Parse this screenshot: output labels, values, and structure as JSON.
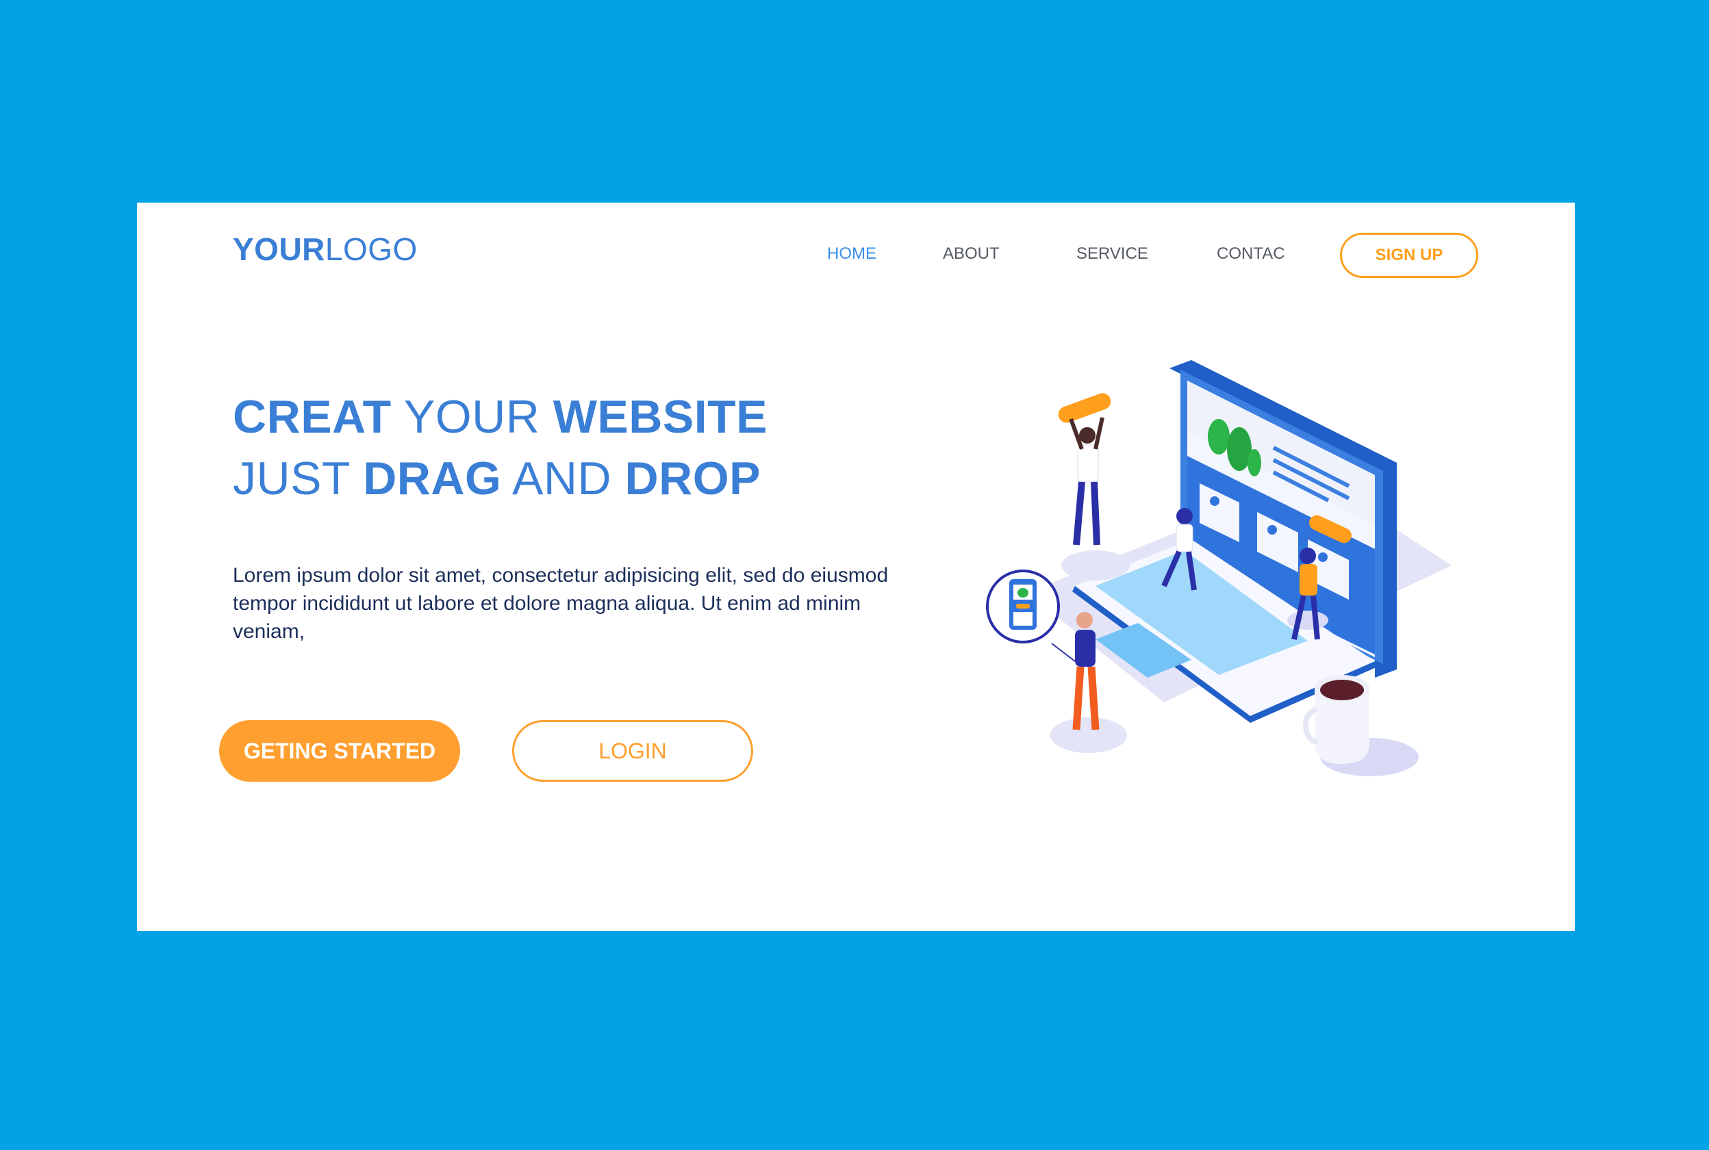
{
  "brand": {
    "logo_strong": "YOUR",
    "logo_light": "LOGO"
  },
  "nav": {
    "items": [
      {
        "label": "HOME",
        "active": true
      },
      {
        "label": "ABOUT",
        "active": false
      },
      {
        "label": "SERVICE",
        "active": false
      },
      {
        "label": "CONTAC",
        "active": false
      }
    ],
    "signup_label": "SIGN UP"
  },
  "hero": {
    "line1": {
      "w1": "CREAT",
      "w2": "YOUR",
      "w3": "WEBSITE"
    },
    "line2": {
      "w1": "JUST",
      "w2": "DRAG",
      "w3": "AND",
      "w4": "DROP"
    },
    "description": "Lorem ipsum dolor sit amet, consectetur adipisicing elit, sed do eiusmod tempor incididunt ut labore et dolore magna aliqua. Ut enim ad minim veniam,",
    "primary_button": "GETING STARTED",
    "secondary_button": "LOGIN"
  },
  "colors": {
    "background": "#02A2E7",
    "card": "#FFFFFF",
    "brand_blue": "#3A7FD5",
    "accent_orange": "#FF9F2F",
    "nav_active": "#3A8EEA",
    "text_dark": "#1C2F5A"
  },
  "illustration": {
    "icons": [
      "laptop-icon",
      "coffee-cup-icon",
      "phone-badge-icon",
      "person-icon",
      "leaf-icon"
    ]
  }
}
